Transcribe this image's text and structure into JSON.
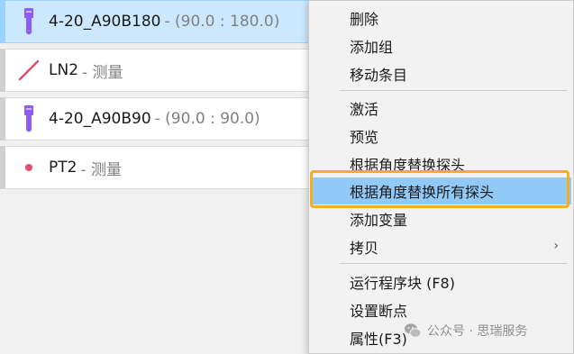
{
  "features": [
    {
      "title": "4-20_A90B180",
      "subtitle": "- (90.0 : 180.0)",
      "icon": "probe-icon",
      "selected": true
    },
    {
      "title": "LN2",
      "subtitle": "- 测量",
      "icon": "line-icon",
      "selected": false
    },
    {
      "title": "4-20_A90B90",
      "subtitle": "- (90.0 : 90.0)",
      "icon": "probe-icon",
      "selected": false
    },
    {
      "title": "PT2",
      "subtitle": "- 测量",
      "icon": "point-icon",
      "selected": false
    }
  ],
  "menu": {
    "items": [
      {
        "label": "删除"
      },
      {
        "label": "添加组"
      },
      {
        "label": "移动条目"
      },
      {
        "label": "激活"
      },
      {
        "label": "预览"
      },
      {
        "label": "根据角度替换探头"
      },
      {
        "label": "根据角度替换所有探头",
        "highlighted": true
      },
      {
        "label": "添加变量"
      },
      {
        "label": "拷贝",
        "submenu_arrow": "›"
      },
      {
        "label": "运行程序块 (F8)"
      },
      {
        "label": "设置断点"
      },
      {
        "label": "属性(F3)"
      }
    ]
  },
  "watermark": {
    "text": "公众号 · 思瑞服务"
  },
  "colors": {
    "selected_bg": "#cce8ff",
    "menu_highlight": "#91c9f7",
    "callout_border": "#f5ae1d",
    "probe": "#8b5cf6",
    "line": "#e0506e",
    "point": "#e0506e"
  }
}
